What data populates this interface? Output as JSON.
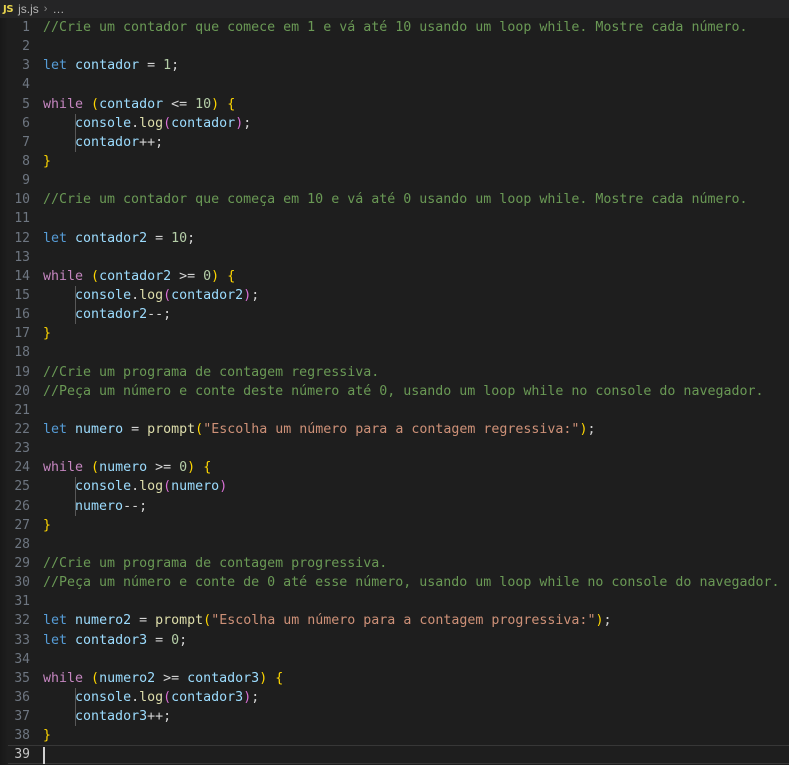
{
  "breadcrumb": {
    "file_icon": "js-file-icon",
    "file_icon_label": "JS",
    "file_name": "js.js",
    "separator": "›",
    "ellipsis": "…"
  },
  "editor": {
    "language": "javascript",
    "total_lines": 39,
    "active_line": 39,
    "cursor": {
      "line": 39,
      "column": 1
    },
    "colors": {
      "background": "#1e1e1e",
      "breadcrumb_background": "#252526",
      "line_number": "#6e7681",
      "line_number_active": "#c6c6c6",
      "foreground": "#d4d4d4",
      "comment": "#6a9955",
      "keyword": "#c586c0",
      "declaration": "#569cd6",
      "variable": "#9cdcfe",
      "function": "#dcdcaa",
      "number": "#b5cea8",
      "string": "#ce9178",
      "bracket_level_1": "#ffd700",
      "bracket_level_2": "#da70d6",
      "indent_guide": "#585858",
      "cursor": "#d0d0d0"
    },
    "lines": [
      {
        "n": 1,
        "indent": false,
        "tokens": [
          {
            "t": "comment",
            "s": "//Crie um contador que comece em 1 e vá até 10 usando um loop while. Mostre cada número."
          }
        ]
      },
      {
        "n": 2,
        "indent": false,
        "tokens": []
      },
      {
        "n": 3,
        "indent": false,
        "tokens": [
          {
            "t": "decl",
            "s": "let"
          },
          {
            "t": "punc",
            "s": " "
          },
          {
            "t": "var",
            "s": "contador"
          },
          {
            "t": "punc",
            "s": " = "
          },
          {
            "t": "num",
            "s": "1"
          },
          {
            "t": "punc",
            "s": ";"
          }
        ]
      },
      {
        "n": 4,
        "indent": false,
        "tokens": []
      },
      {
        "n": 5,
        "indent": false,
        "tokens": [
          {
            "t": "keyword",
            "s": "while"
          },
          {
            "t": "punc",
            "s": " "
          },
          {
            "t": "p1",
            "s": "("
          },
          {
            "t": "var",
            "s": "contador"
          },
          {
            "t": "punc",
            "s": " <= "
          },
          {
            "t": "num",
            "s": "10"
          },
          {
            "t": "p1",
            "s": ")"
          },
          {
            "t": "punc",
            "s": " "
          },
          {
            "t": "p1",
            "s": "{"
          }
        ]
      },
      {
        "n": 6,
        "indent": true,
        "tokens": [
          {
            "t": "punc",
            "s": "    "
          },
          {
            "t": "var",
            "s": "console"
          },
          {
            "t": "punc",
            "s": "."
          },
          {
            "t": "func",
            "s": "log"
          },
          {
            "t": "p2",
            "s": "("
          },
          {
            "t": "var",
            "s": "contador"
          },
          {
            "t": "p2",
            "s": ")"
          },
          {
            "t": "punc",
            "s": ";"
          }
        ]
      },
      {
        "n": 7,
        "indent": true,
        "tokens": [
          {
            "t": "punc",
            "s": "    "
          },
          {
            "t": "var",
            "s": "contador"
          },
          {
            "t": "punc",
            "s": "++;"
          }
        ]
      },
      {
        "n": 8,
        "indent": false,
        "tokens": [
          {
            "t": "p1",
            "s": "}"
          }
        ]
      },
      {
        "n": 9,
        "indent": false,
        "tokens": []
      },
      {
        "n": 10,
        "indent": false,
        "tokens": [
          {
            "t": "comment",
            "s": "//Crie um contador que começa em 10 e vá até 0 usando um loop while. Mostre cada número."
          }
        ]
      },
      {
        "n": 11,
        "indent": false,
        "tokens": []
      },
      {
        "n": 12,
        "indent": false,
        "tokens": [
          {
            "t": "decl",
            "s": "let"
          },
          {
            "t": "punc",
            "s": " "
          },
          {
            "t": "var",
            "s": "contador2"
          },
          {
            "t": "punc",
            "s": " = "
          },
          {
            "t": "num",
            "s": "10"
          },
          {
            "t": "punc",
            "s": ";"
          }
        ]
      },
      {
        "n": 13,
        "indent": false,
        "tokens": []
      },
      {
        "n": 14,
        "indent": false,
        "tokens": [
          {
            "t": "keyword",
            "s": "while"
          },
          {
            "t": "punc",
            "s": " "
          },
          {
            "t": "p1",
            "s": "("
          },
          {
            "t": "var",
            "s": "contador2"
          },
          {
            "t": "punc",
            "s": " >= "
          },
          {
            "t": "num",
            "s": "0"
          },
          {
            "t": "p1",
            "s": ")"
          },
          {
            "t": "punc",
            "s": " "
          },
          {
            "t": "p1",
            "s": "{"
          }
        ]
      },
      {
        "n": 15,
        "indent": true,
        "tokens": [
          {
            "t": "punc",
            "s": "    "
          },
          {
            "t": "var",
            "s": "console"
          },
          {
            "t": "punc",
            "s": "."
          },
          {
            "t": "func",
            "s": "log"
          },
          {
            "t": "p2",
            "s": "("
          },
          {
            "t": "var",
            "s": "contador2"
          },
          {
            "t": "p2",
            "s": ")"
          },
          {
            "t": "punc",
            "s": ";"
          }
        ]
      },
      {
        "n": 16,
        "indent": true,
        "tokens": [
          {
            "t": "punc",
            "s": "    "
          },
          {
            "t": "var",
            "s": "contador2"
          },
          {
            "t": "punc",
            "s": "--;"
          }
        ]
      },
      {
        "n": 17,
        "indent": false,
        "tokens": [
          {
            "t": "p1",
            "s": "}"
          }
        ]
      },
      {
        "n": 18,
        "indent": false,
        "tokens": []
      },
      {
        "n": 19,
        "indent": false,
        "tokens": [
          {
            "t": "comment",
            "s": "//Crie um programa de contagem regressiva."
          }
        ]
      },
      {
        "n": 20,
        "indent": false,
        "tokens": [
          {
            "t": "comment",
            "s": "//Peça um número e conte deste número até 0, usando um loop while no console do navegador."
          }
        ]
      },
      {
        "n": 21,
        "indent": false,
        "tokens": []
      },
      {
        "n": 22,
        "indent": false,
        "tokens": [
          {
            "t": "decl",
            "s": "let"
          },
          {
            "t": "punc",
            "s": " "
          },
          {
            "t": "var",
            "s": "numero"
          },
          {
            "t": "punc",
            "s": " = "
          },
          {
            "t": "func",
            "s": "prompt"
          },
          {
            "t": "p1",
            "s": "("
          },
          {
            "t": "str",
            "s": "\"Escolha um número para a contagem regressiva:\""
          },
          {
            "t": "p1",
            "s": ")"
          },
          {
            "t": "punc",
            "s": ";"
          }
        ]
      },
      {
        "n": 23,
        "indent": false,
        "tokens": []
      },
      {
        "n": 24,
        "indent": false,
        "tokens": [
          {
            "t": "keyword",
            "s": "while"
          },
          {
            "t": "punc",
            "s": " "
          },
          {
            "t": "p1",
            "s": "("
          },
          {
            "t": "var",
            "s": "numero"
          },
          {
            "t": "punc",
            "s": " >= "
          },
          {
            "t": "num",
            "s": "0"
          },
          {
            "t": "p1",
            "s": ")"
          },
          {
            "t": "punc",
            "s": " "
          },
          {
            "t": "p1",
            "s": "{"
          }
        ]
      },
      {
        "n": 25,
        "indent": true,
        "tokens": [
          {
            "t": "punc",
            "s": "    "
          },
          {
            "t": "var",
            "s": "console"
          },
          {
            "t": "punc",
            "s": "."
          },
          {
            "t": "func",
            "s": "log"
          },
          {
            "t": "p2",
            "s": "("
          },
          {
            "t": "var",
            "s": "numero"
          },
          {
            "t": "p2",
            "s": ")"
          }
        ]
      },
      {
        "n": 26,
        "indent": true,
        "tokens": [
          {
            "t": "punc",
            "s": "    "
          },
          {
            "t": "var",
            "s": "numero"
          },
          {
            "t": "punc",
            "s": "--;"
          }
        ]
      },
      {
        "n": 27,
        "indent": false,
        "tokens": [
          {
            "t": "p1",
            "s": "}"
          }
        ]
      },
      {
        "n": 28,
        "indent": false,
        "tokens": []
      },
      {
        "n": 29,
        "indent": false,
        "tokens": [
          {
            "t": "comment",
            "s": "//Crie um programa de contagem progressiva."
          }
        ]
      },
      {
        "n": 30,
        "indent": false,
        "tokens": [
          {
            "t": "comment",
            "s": "//Peça um número e conte de 0 até esse número, usando um loop while no console do navegador."
          }
        ]
      },
      {
        "n": 31,
        "indent": false,
        "tokens": []
      },
      {
        "n": 32,
        "indent": false,
        "tokens": [
          {
            "t": "decl",
            "s": "let"
          },
          {
            "t": "punc",
            "s": " "
          },
          {
            "t": "var",
            "s": "numero2"
          },
          {
            "t": "punc",
            "s": " = "
          },
          {
            "t": "func",
            "s": "prompt"
          },
          {
            "t": "p1",
            "s": "("
          },
          {
            "t": "str",
            "s": "\"Escolha um número para a contagem progressiva:\""
          },
          {
            "t": "p1",
            "s": ")"
          },
          {
            "t": "punc",
            "s": ";"
          }
        ]
      },
      {
        "n": 33,
        "indent": false,
        "tokens": [
          {
            "t": "decl",
            "s": "let"
          },
          {
            "t": "punc",
            "s": " "
          },
          {
            "t": "var",
            "s": "contador3"
          },
          {
            "t": "punc",
            "s": " = "
          },
          {
            "t": "num",
            "s": "0"
          },
          {
            "t": "punc",
            "s": ";"
          }
        ]
      },
      {
        "n": 34,
        "indent": false,
        "tokens": []
      },
      {
        "n": 35,
        "indent": false,
        "tokens": [
          {
            "t": "keyword",
            "s": "while"
          },
          {
            "t": "punc",
            "s": " "
          },
          {
            "t": "p1",
            "s": "("
          },
          {
            "t": "var",
            "s": "numero2"
          },
          {
            "t": "punc",
            "s": " >= "
          },
          {
            "t": "var",
            "s": "contador3"
          },
          {
            "t": "p1",
            "s": ")"
          },
          {
            "t": "punc",
            "s": " "
          },
          {
            "t": "p1",
            "s": "{"
          }
        ]
      },
      {
        "n": 36,
        "indent": true,
        "tokens": [
          {
            "t": "punc",
            "s": "    "
          },
          {
            "t": "var",
            "s": "console"
          },
          {
            "t": "punc",
            "s": "."
          },
          {
            "t": "func",
            "s": "log"
          },
          {
            "t": "p2",
            "s": "("
          },
          {
            "t": "var",
            "s": "contador3"
          },
          {
            "t": "p2",
            "s": ")"
          },
          {
            "t": "punc",
            "s": ";"
          }
        ]
      },
      {
        "n": 37,
        "indent": true,
        "tokens": [
          {
            "t": "punc",
            "s": "    "
          },
          {
            "t": "var",
            "s": "contador3"
          },
          {
            "t": "punc",
            "s": "++;"
          }
        ]
      },
      {
        "n": 38,
        "indent": false,
        "tokens": [
          {
            "t": "p1",
            "s": "}"
          }
        ]
      },
      {
        "n": 39,
        "indent": false,
        "tokens": []
      }
    ]
  }
}
